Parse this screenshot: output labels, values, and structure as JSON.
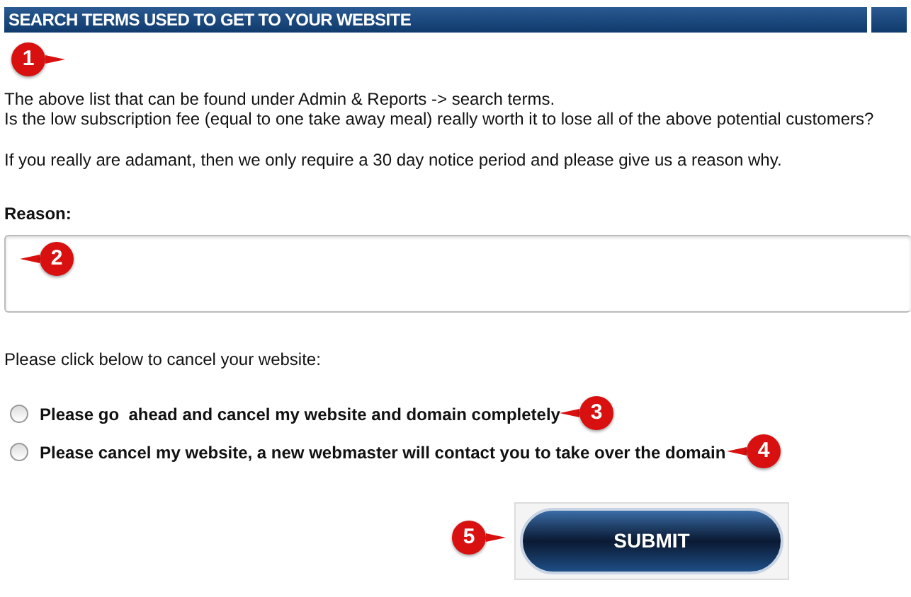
{
  "header": {
    "title": "SEARCH TERMS USED TO GET TO YOUR WEBSITE"
  },
  "intro": [
    "The above list that can be found under Admin & Reports -> search terms.",
    "Is the low subscription fee (equal to one take away meal) really worth it to lose all of the above potential customers?"
  ],
  "notice": "If you really are adamant, then we only require a 30 day notice period and please give us a reason why.",
  "reason": {
    "label": "Reason:"
  },
  "cancel_prompt": "Please click below to cancel your website:",
  "options": [
    {
      "label": "Please go  ahead and cancel my website and domain completely",
      "selected": false
    },
    {
      "label": "Please cancel my website, a new webmaster will contact you to take over the domain",
      "selected": false
    }
  ],
  "submit": {
    "label": "SUBMIT"
  },
  "callouts": [
    "1",
    "2",
    "3",
    "4",
    "5"
  ]
}
